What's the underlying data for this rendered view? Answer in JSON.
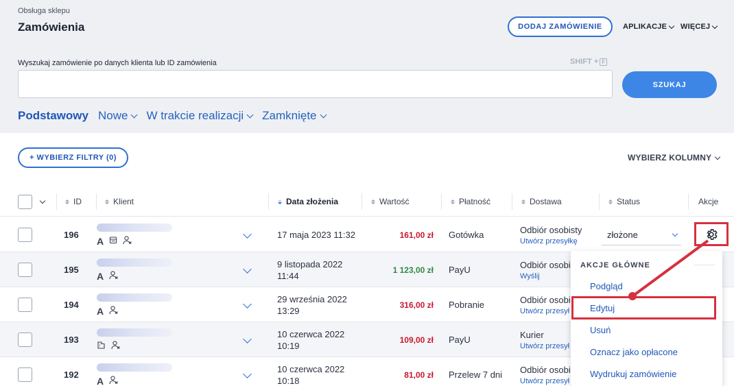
{
  "header": {
    "breadcrumb": "Obsługa sklepu",
    "title": "Zamówienia",
    "add_order_label": "DODAJ ZAMÓWIENIE",
    "apps_label": "APLIKACJE",
    "more_label": "WIĘCEJ"
  },
  "search": {
    "label": "Wyszukaj zamówienie po danych klienta lub ID zamówienia",
    "shortcut_prefix": "SHIFT +",
    "shortcut_key": "F",
    "value": "",
    "placeholder": "",
    "button_label": "SZUKAJ"
  },
  "tabs": [
    {
      "label": "Podstawowy",
      "active": true
    },
    {
      "label": "Nowe",
      "active": false
    },
    {
      "label": "W trakcie realizacji",
      "active": false
    },
    {
      "label": "Zamknięte",
      "active": false
    }
  ],
  "toolbar": {
    "filters_label": "+ WYBIERZ FILTRY (0)",
    "columns_label": "WYBIERZ KOLUMNY"
  },
  "table": {
    "headers": {
      "id": "ID",
      "client": "Klient",
      "date": "Data złożenia",
      "value": "Wartość",
      "payment": "Płatność",
      "delivery": "Dostawa",
      "status": "Status",
      "actions": "Akcje"
    },
    "rows": [
      {
        "id": "196",
        "client_icons": [
          "A",
          "document-icon",
          "user-x-icon"
        ],
        "date_line1": "17 maja 2023 11:32",
        "date_line2": "",
        "value": "161,00 zł",
        "value_color": "red",
        "payment": "Gotówka",
        "delivery": "Odbiór osobisty",
        "delivery_link": "Utwórz przesyłkę",
        "status": "złożone"
      },
      {
        "id": "195",
        "client_icons": [
          "A",
          "user-x-icon"
        ],
        "date_line1": "9 listopada 2022",
        "date_line2": "11:44",
        "value": "1 123,00 zł",
        "value_color": "green",
        "payment": "PayU",
        "delivery": "Odbiór osobi",
        "delivery_link": "Wyślij",
        "status": ""
      },
      {
        "id": "194",
        "client_icons": [
          "A",
          "user-x-icon"
        ],
        "date_line1": "29 września 2022",
        "date_line2": "13:29",
        "value": "316,00 zł",
        "value_color": "red",
        "payment": "Pobranie",
        "delivery": "Odbiór osobi",
        "delivery_link": "Utwórz przesył",
        "status": ""
      },
      {
        "id": "193",
        "client_icons": [
          "company-icon",
          "user-x-icon"
        ],
        "date_line1": "10 czerwca 2022",
        "date_line2": "10:19",
        "value": "109,00 zł",
        "value_color": "red",
        "payment": "PayU",
        "delivery": "Kurier",
        "delivery_link": "Utwórz przesył",
        "status": ""
      },
      {
        "id": "192",
        "client_icons": [
          "A",
          "user-x-icon"
        ],
        "date_line1": "10 czerwca 2022",
        "date_line2": "10:18",
        "value": "81,00 zł",
        "value_color": "red",
        "payment": "Przelew 7 dni",
        "delivery": "Odbiór osobi",
        "delivery_link": "Utwórz przesył",
        "status": ""
      }
    ]
  },
  "actions_menu": {
    "heading": "AKCJE GŁÓWNE",
    "items": [
      "Podgląd",
      "Edytuj",
      "Usuń",
      "Oznacz jako opłacone",
      "Wydrukuj zamówienie"
    ],
    "highlighted": "Edytuj"
  },
  "colors": {
    "accent": "#2d6fd6",
    "highlight": "#d6303e",
    "value_red": "#c8182e",
    "value_green": "#2f8a45"
  }
}
